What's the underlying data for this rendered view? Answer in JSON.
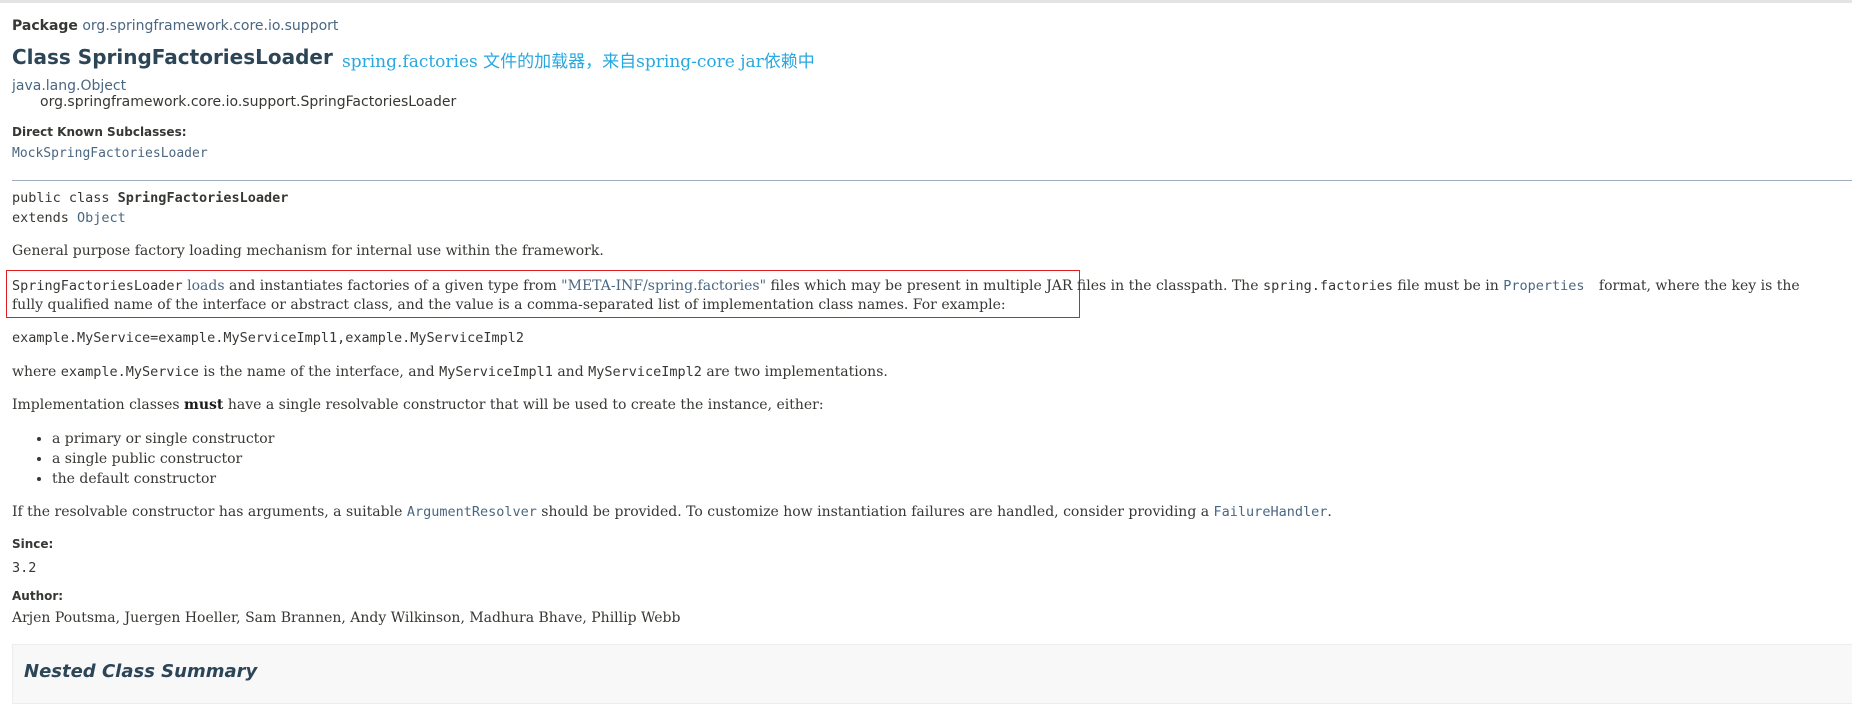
{
  "header": {
    "package_label": "Package",
    "package_name": "org.springframework.core.io.support",
    "class_title": "Class SpringFactoriesLoader",
    "annotation_note": "spring.factories 文件的加载器，来自spring-core jar依赖中"
  },
  "inheritance": {
    "parent": "java.lang.Object",
    "child": "org.springframework.core.io.support.SpringFactoriesLoader"
  },
  "subclasses": {
    "label": "Direct Known Subclasses:",
    "items": [
      "MockSpringFactoriesLoader"
    ]
  },
  "signature": {
    "prefix": "public class ",
    "name": "SpringFactoriesLoader",
    "extends_kw": "extends ",
    "extends_type": "Object"
  },
  "description": {
    "intro": "General purpose factory loading mechanism for internal use within the framework.",
    "p2_code": "SpringFactoriesLoader",
    "p2_loads": "loads",
    "p2_t1": " and instantiates factories of a given type from ",
    "p2_path": "\"META-INF/spring.factories\"",
    "p2_t2": " files which may be present in multiple JAR files in the classpath. The ",
    "p2_file": "spring.factories",
    "p2_t3": " file must be in ",
    "p2_props": "Properties",
    "p2_t4": " format, where the key is the fully qualified name of the interface or abstract class, and the value is a comma-separated list of implementation class names. For example:",
    "example_code": "example.MyService=example.MyServiceImpl1,example.MyServiceImpl2",
    "p3_t1": "where ",
    "p3_code1": "example.MyService",
    "p3_t2": " is the name of the interface, and ",
    "p3_code2": "MyServiceImpl1",
    "p3_t3": " and ",
    "p3_code3": "MyServiceImpl2",
    "p3_t4": " are two implementations.",
    "p4_t1": "Implementation classes ",
    "p4_bold": "must",
    "p4_t2": " have a single resolvable constructor that will be used to create the instance, either:",
    "bullets": [
      "a primary or single constructor",
      "a single public constructor",
      "the default constructor"
    ],
    "p5_t1": "If the resolvable constructor has arguments, a suitable ",
    "p5_link1": "ArgumentResolver",
    "p5_t2": " should be provided. To customize how instantiation failures are handled, consider providing a ",
    "p5_link2": "FailureHandler",
    "p5_t3": "."
  },
  "since": {
    "label": "Since:",
    "value": "3.2"
  },
  "author": {
    "label": "Author:",
    "value": "Arjen Poutsma, Juergen Hoeller, Sam Brannen, Andy Wilkinson, Madhura Bhave, Phillip Webb"
  },
  "nested_summary": {
    "title": "Nested Class Summary"
  },
  "colors": {
    "link": "#4a6782",
    "title": "#2c4557",
    "annotation": "#28a8e0",
    "highlight_box": "#e02020"
  }
}
